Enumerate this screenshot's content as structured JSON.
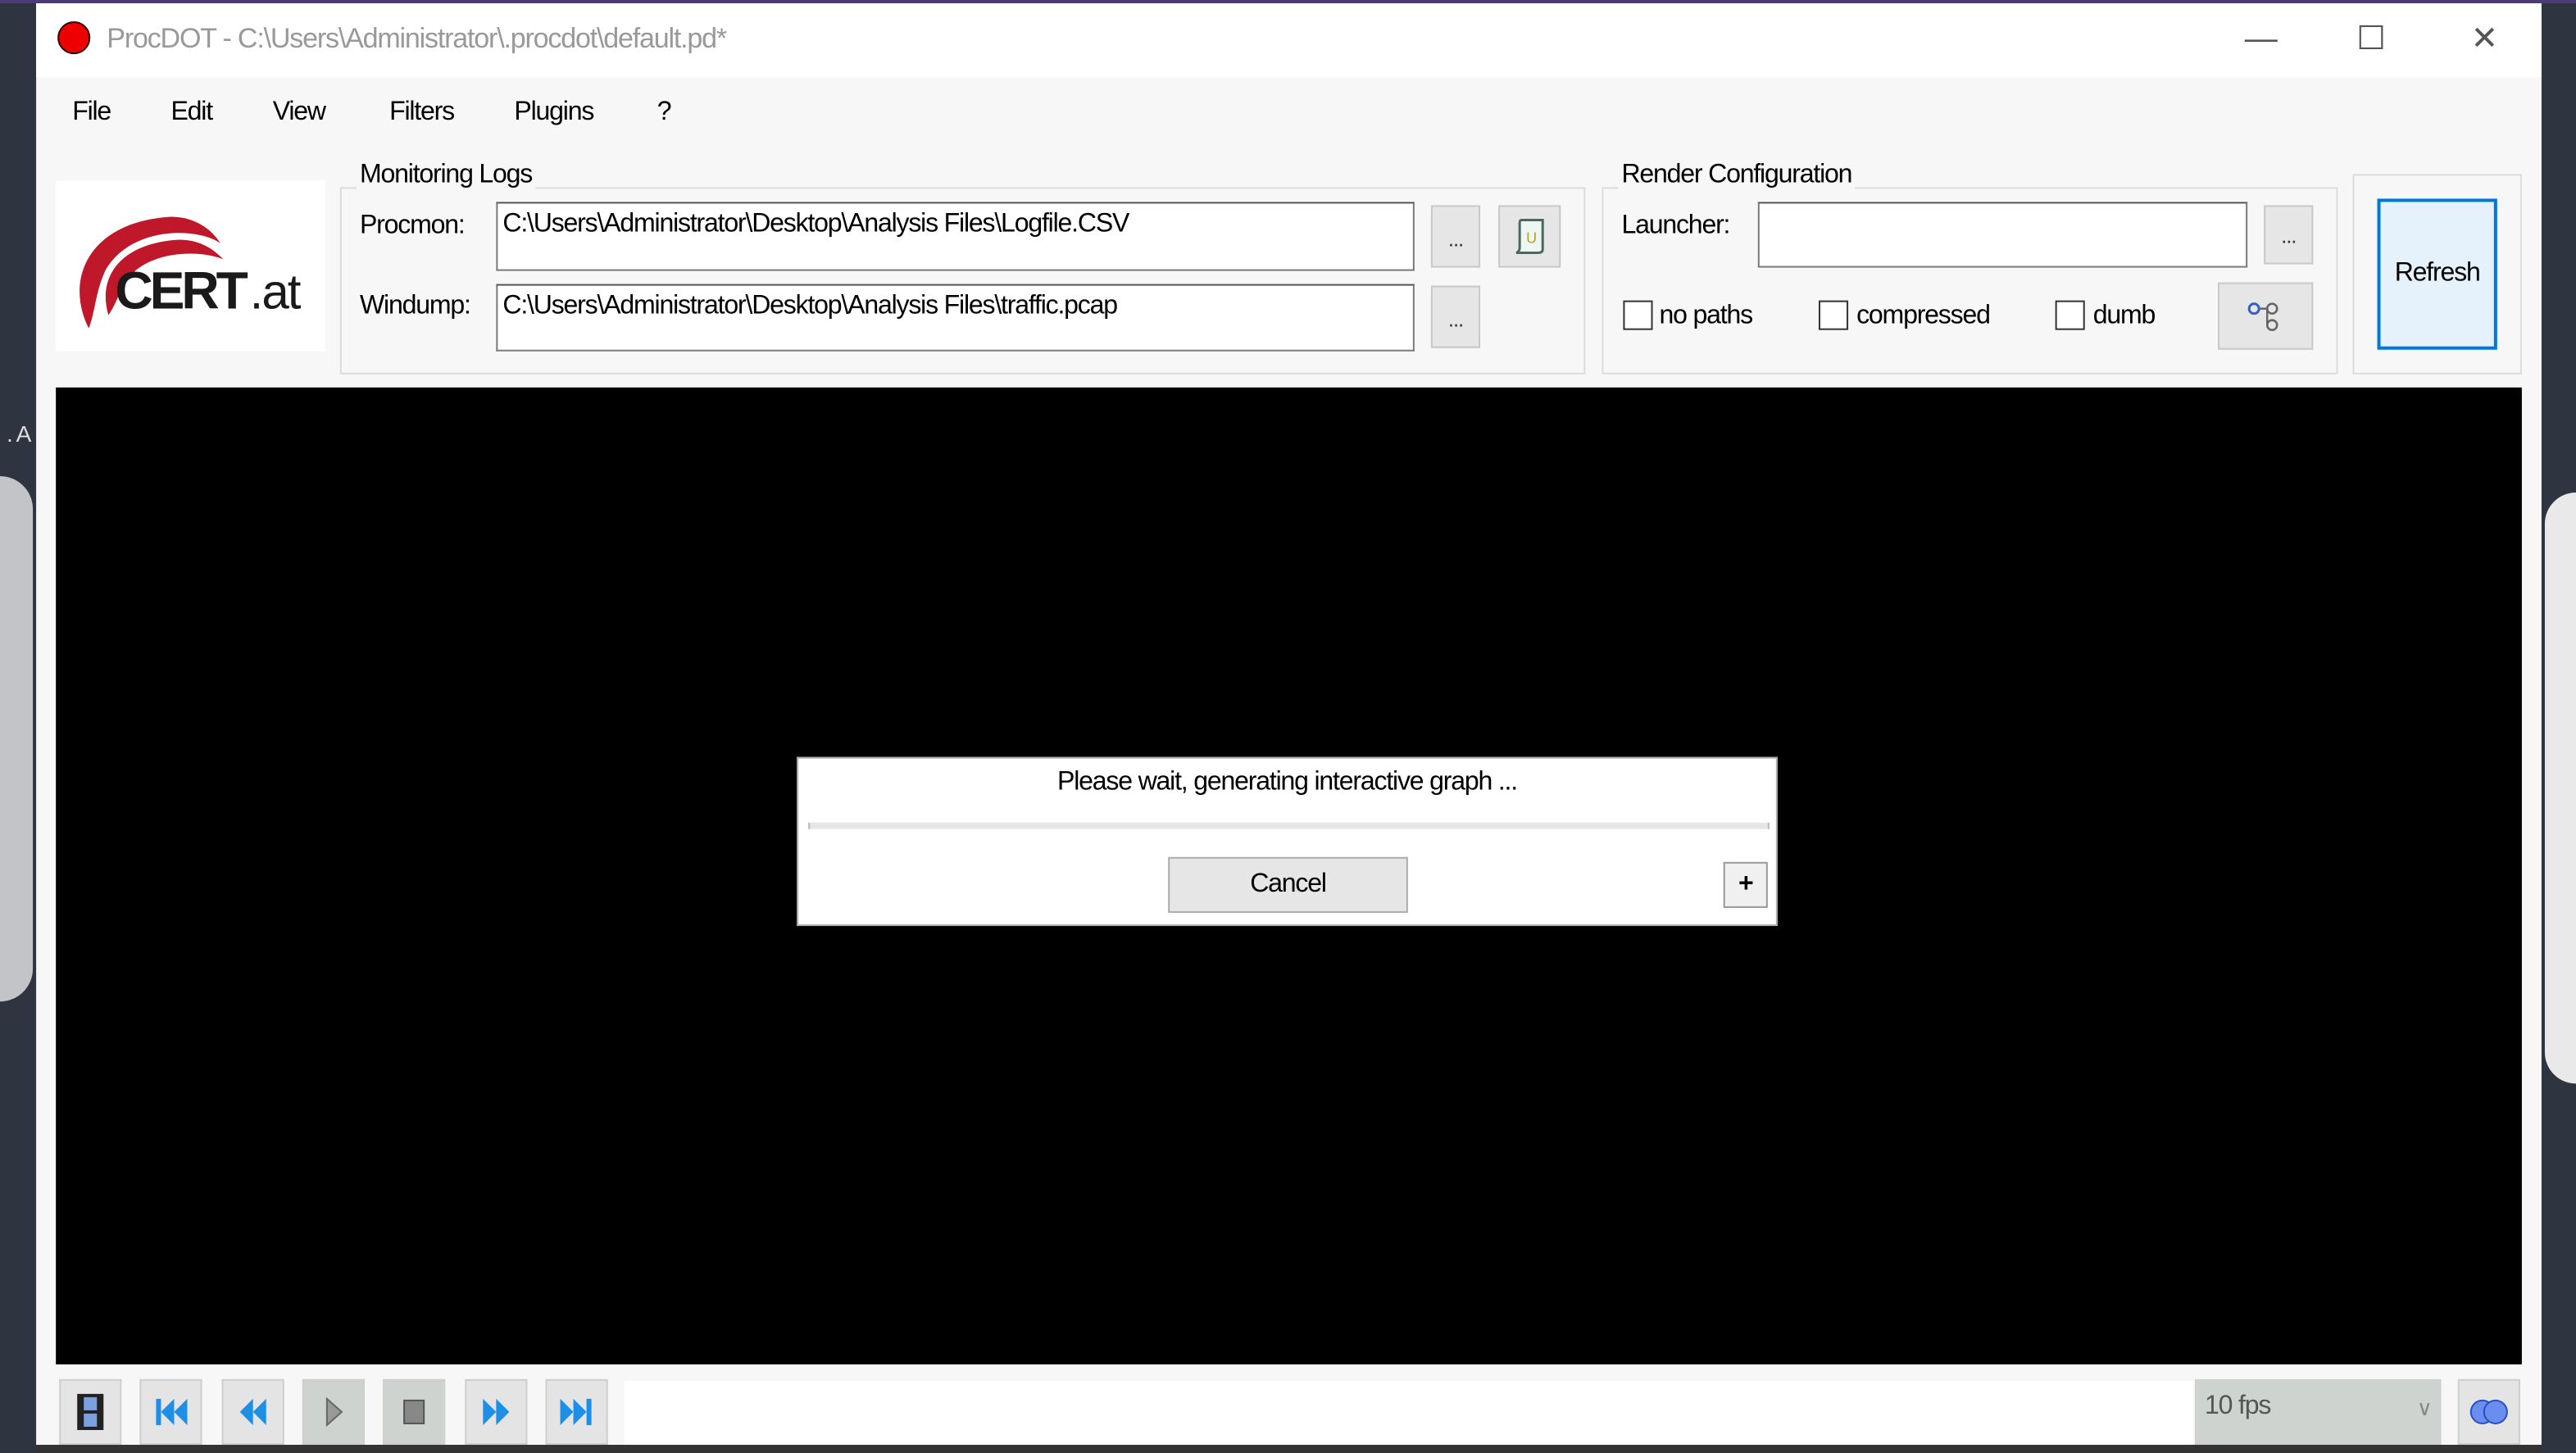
{
  "window": {
    "title": "ProcDOT - C:\\Users\\Administrator\\.procdot\\default.pd*",
    "controls": {
      "minimize": "—",
      "maximize": "☐",
      "close": "✕"
    }
  },
  "menu": [
    "File",
    "Edit",
    "View",
    "Filters",
    "Plugins",
    "?"
  ],
  "logo": {
    "text": "CERT.at",
    "color": "#c0182b"
  },
  "monitoring": {
    "group_label": "Monitoring Logs",
    "procmon_label": "Procmon:",
    "procmon_value": "C:\\Users\\Administrator\\Desktop\\Analysis Files\\Logfile.CSV",
    "windump_label": "Windump:",
    "windump_value": "C:\\Users\\Administrator\\Desktop\\Analysis Files\\traffic.pcap",
    "browse_label": "...",
    "icon": "scroll-icon"
  },
  "render": {
    "group_label": "Render Configuration",
    "launcher_label": "Launcher:",
    "launcher_value": "",
    "browse_label": "...",
    "checkboxes": [
      {
        "label": "no paths",
        "checked": false
      },
      {
        "label": "compressed",
        "checked": false
      },
      {
        "label": "dumb",
        "checked": false
      }
    ],
    "icon": "graph-layout-icon"
  },
  "refresh_label": "Refresh",
  "dialog": {
    "message": "Please wait, generating interactive graph ...",
    "progress": 0,
    "cancel_label": "Cancel",
    "expand_label": "+"
  },
  "toolbar": {
    "buttons": [
      "film-icon",
      "skip-first-icon",
      "rewind-icon",
      "play-icon",
      "stop-icon",
      "fast-forward-icon",
      "skip-last-icon"
    ],
    "fps": "10 fps",
    "right_icon": "link-icon"
  },
  "colors": {
    "accent": "#0078d7",
    "play_blue": "#1e8fe6"
  }
}
